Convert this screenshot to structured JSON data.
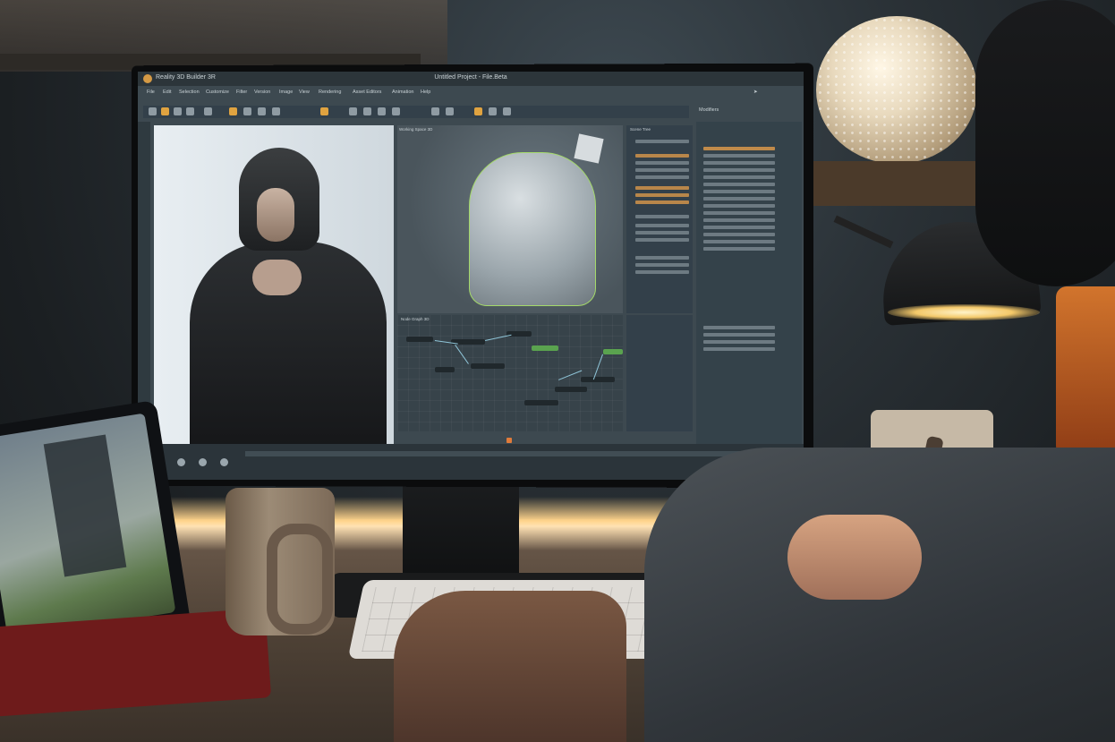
{
  "app": {
    "title": "Reality 3D Builder 3R",
    "project_title": "Untitled Project - File.Beta"
  },
  "menu": [
    "File",
    "Edit",
    "Selection",
    "Customize",
    "Filter",
    "Version",
    "Image",
    "View",
    "Rendering",
    "Asset Editors",
    "Animation",
    "Help"
  ],
  "panels": {
    "viewport": "Working Space 3D",
    "node_graph": "Node Graph 3D",
    "scene": "Scene Tree",
    "modifiers": "Modifiers"
  },
  "icons": {
    "app": "app-logo-icon",
    "play": "play-icon",
    "share": "share-icon"
  },
  "colors": {
    "accent": "#e0a340",
    "playhead": "#e07b3a",
    "selection": "#a4d96a"
  }
}
